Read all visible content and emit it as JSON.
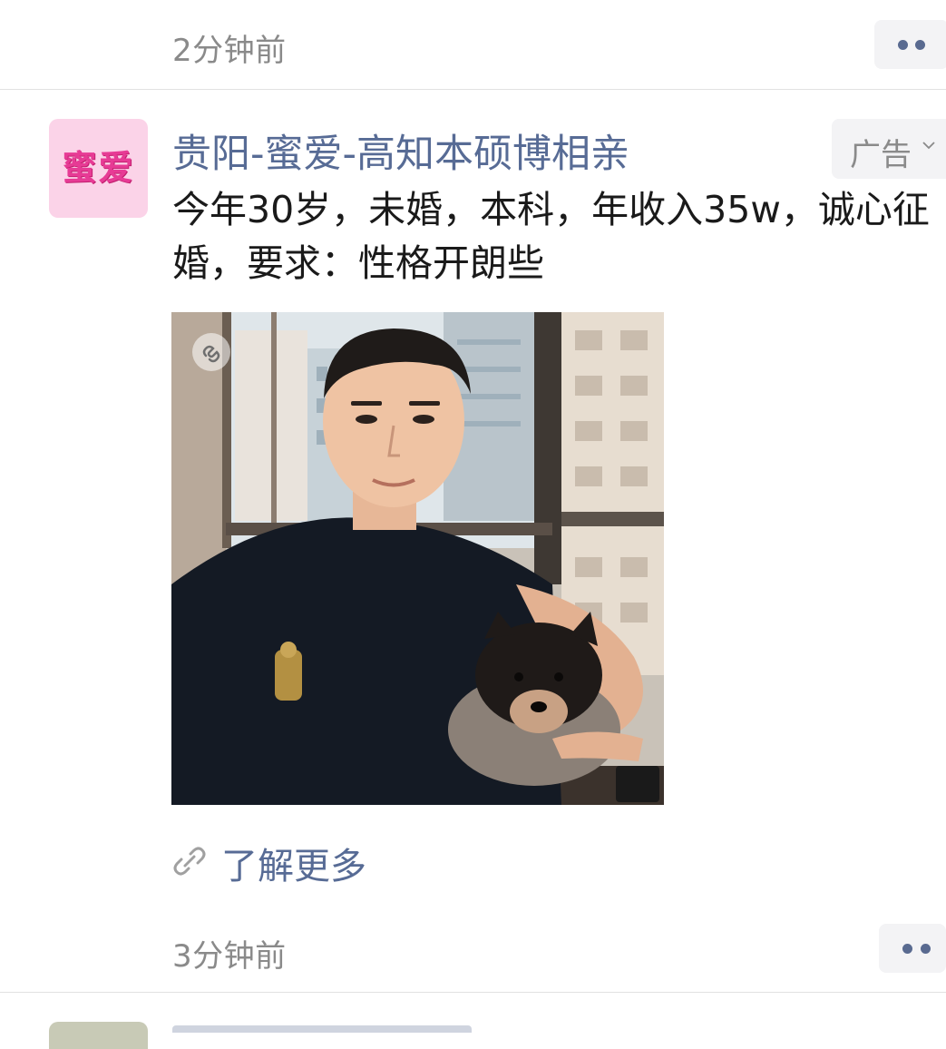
{
  "previous_post": {
    "time": "2分钟前"
  },
  "ad_post": {
    "avatar_text": "蜜爱",
    "author": "贵阳-蜜爱-高知本硕博相亲",
    "ad_label": "广告",
    "body": "今年30岁，未婚，本科，年收入35w，诚心征婚，要求：性格开朗些",
    "link_label": "了解更多",
    "time": "3分钟前"
  },
  "colors": {
    "link_blue": "#576b95",
    "meta_gray": "#8a8a8a",
    "button_bg": "#f3f3f5",
    "avatar_bg": "#fbd3e8",
    "avatar_text": "#e73b95"
  },
  "icons": {
    "more": "more-dots-icon",
    "ad_menu": "chevron-down-icon",
    "link": "link-chain-icon",
    "mini_program": "mini-program-icon"
  }
}
